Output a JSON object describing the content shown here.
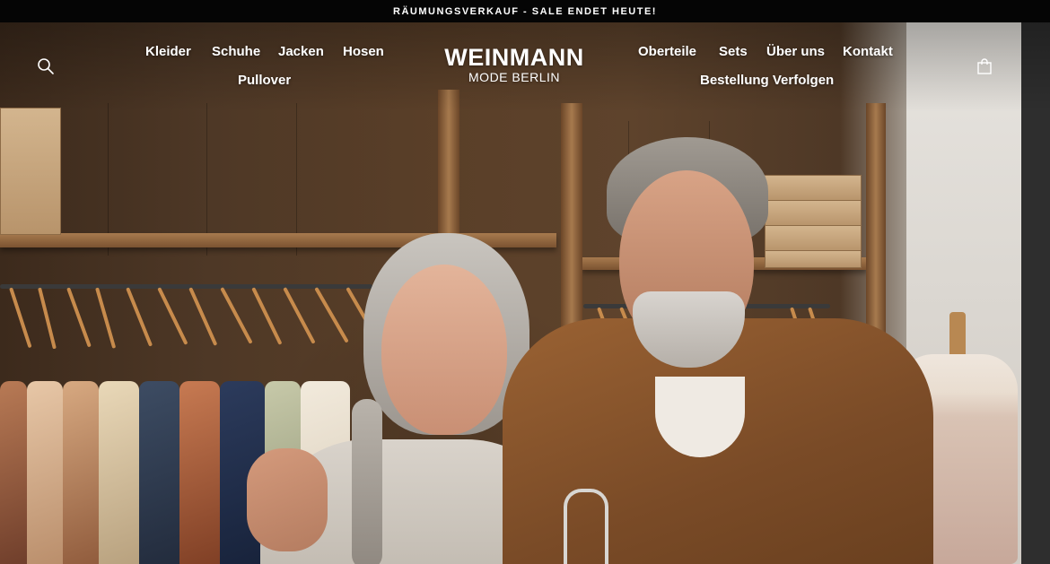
{
  "announcement": {
    "text": "RÄUMUNGSVERKAUF - SALE ENDET HEUTE!"
  },
  "logo": {
    "name": "WEINMANN",
    "subtitle": "MODE BERLIN"
  },
  "nav_left": [
    {
      "label": "Kleider"
    },
    {
      "label": "Schuhe"
    },
    {
      "label": "Jacken"
    },
    {
      "label": "Hosen"
    },
    {
      "label": "Pullover"
    }
  ],
  "nav_right": [
    {
      "label": "Oberteile"
    },
    {
      "label": "Sets"
    },
    {
      "label": "Über uns"
    },
    {
      "label": "Kontakt"
    },
    {
      "label": "Bestellung Verfolgen"
    }
  ],
  "icons": {
    "search": "search-icon",
    "cart": "shopping-bag-icon"
  },
  "colors": {
    "announcement_bg": "#050505",
    "text": "#ffffff"
  }
}
